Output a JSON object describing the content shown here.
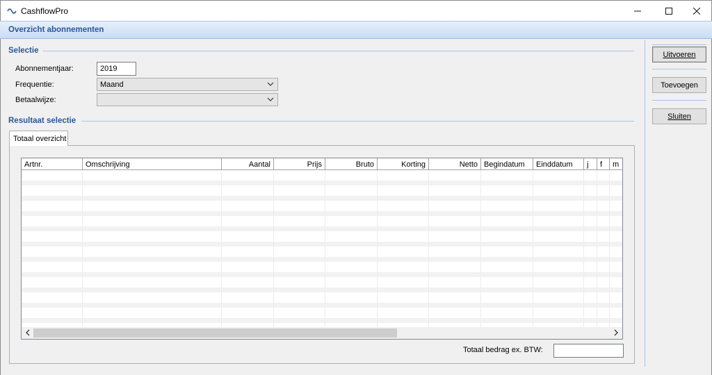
{
  "window": {
    "title": "CashflowPro",
    "controls": {
      "minimize": "─",
      "maximize": "☐",
      "close": "✕"
    }
  },
  "header": {
    "title": "Overzicht abonnementen"
  },
  "selectie": {
    "title": "Selectie",
    "abonnementjaar_label": "Abonnementjaar:",
    "abonnementjaar_value": "2019",
    "frequentie_label": "Frequentie:",
    "frequentie_value": "Maand",
    "betaalwijze_label": "Betaalwijze:",
    "betaalwijze_value": ""
  },
  "resultaat": {
    "title": "Resultaat selectie",
    "tab_label": "Totaal overzicht",
    "columns": [
      "Artnr.",
      "Omschrijving",
      "Aantal",
      "Prijs",
      "Bruto",
      "Korting",
      "Netto",
      "Begindatum",
      "Einddatum",
      "j",
      "f",
      "m"
    ],
    "rows": [],
    "total_label": "Totaal bedrag ex. BTW:",
    "total_value": ""
  },
  "actions": {
    "uitvoeren": "Uitvoeren",
    "toevoegen": "Toevoegen",
    "sluiten": "Sluiten"
  },
  "colors": {
    "accent": "#2b579a",
    "header_gradient_top": "#e7f0fb",
    "header_gradient_bottom": "#c9dcf3",
    "section_line": "#a9c3e2"
  },
  "icons": {
    "app": "cashflow-wave-icon",
    "combo": "chevron-down-icon",
    "scroll_left": "chevron-left-icon",
    "scroll_right": "chevron-right-icon"
  }
}
